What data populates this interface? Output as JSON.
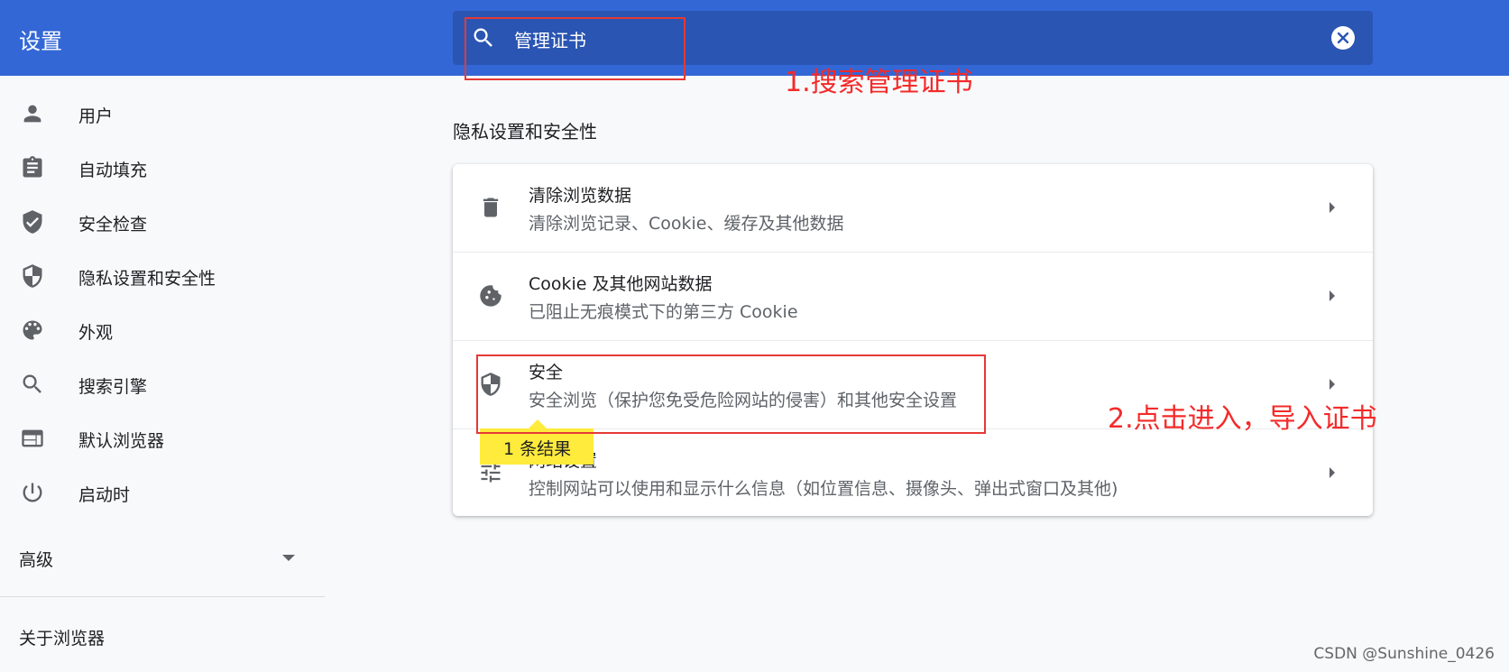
{
  "header": {
    "title": "设置",
    "search_value": "管理证书"
  },
  "sidebar": {
    "items": [
      {
        "label": "用户",
        "icon": "person-icon"
      },
      {
        "label": "自动填充",
        "icon": "clipboard-icon"
      },
      {
        "label": "安全检查",
        "icon": "shield-check-icon"
      },
      {
        "label": "隐私设置和安全性",
        "icon": "shield-half-icon"
      },
      {
        "label": "外观",
        "icon": "palette-icon"
      },
      {
        "label": "搜索引擎",
        "icon": "search-icon"
      },
      {
        "label": "默认浏览器",
        "icon": "browser-window-icon"
      },
      {
        "label": "启动时",
        "icon": "power-icon"
      }
    ],
    "advanced": "高级",
    "about": "关于浏览器"
  },
  "main": {
    "section_title": "隐私设置和安全性",
    "rows": [
      {
        "title": "清除浏览数据",
        "subtitle": "清除浏览记录、Cookie、缓存及其他数据",
        "icon": "trash-icon"
      },
      {
        "title": "Cookie 及其他网站数据",
        "subtitle": "已阻止无痕模式下的第三方 Cookie",
        "icon": "cookie-icon"
      },
      {
        "title": "安全",
        "subtitle": "安全浏览（保护您免受危险网站的侵害）和其他安全设置",
        "icon": "shield-half-icon"
      },
      {
        "title": "网站设置",
        "subtitle": "控制网站可以使用和显示什么信息（如位置信息、摄像头、弹出式窗口及其他)",
        "icon": "tune-icon"
      }
    ],
    "tooltip": "1 条结果"
  },
  "annotations": {
    "step1": "1.搜索管理证书",
    "step2": "2.点击进入，导入证书"
  },
  "watermark": "CSDN @Sunshine_0426",
  "colors": {
    "topbar": "#3367d6",
    "search_box": "#2a55b3",
    "annotation": "#f42a2a",
    "tooltip": "#ffeb3b"
  }
}
